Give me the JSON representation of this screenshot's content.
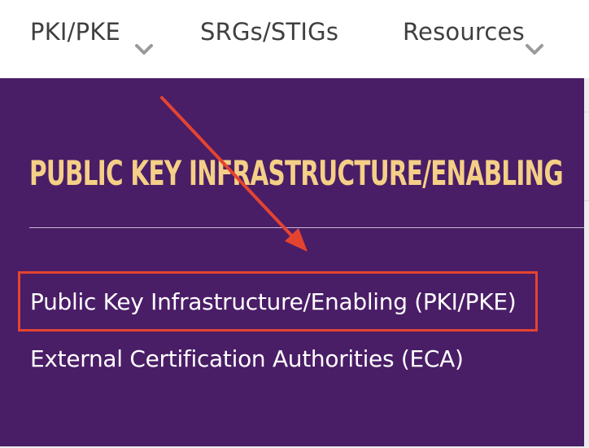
{
  "nav": {
    "items": [
      {
        "label": "PKI/PKE",
        "has_dropdown": true,
        "icon": "chevron-down-icon"
      },
      {
        "label": "SRGs/STIGs",
        "has_dropdown": false
      },
      {
        "label": "Resources",
        "has_dropdown": true,
        "icon": "chevron-down-icon"
      }
    ]
  },
  "main": {
    "heading": "PUBLIC KEY INFRASTRUCTURE/ENABLING",
    "links": [
      {
        "label": "Public Key Infrastructure/Enabling (PKI/PKE)",
        "highlighted": true
      },
      {
        "label": "External Certification Authorities (ECA)",
        "highlighted": false
      }
    ]
  },
  "annotation": {
    "arrow_icon": "red-arrow-icon",
    "box": "red-highlight-box"
  },
  "colors": {
    "panel_background": "#4a1d67",
    "heading": "#f4cf86",
    "link_text": "#ffffff",
    "nav_text": "#3f3f3f",
    "annotation_red": "#e4442f"
  }
}
